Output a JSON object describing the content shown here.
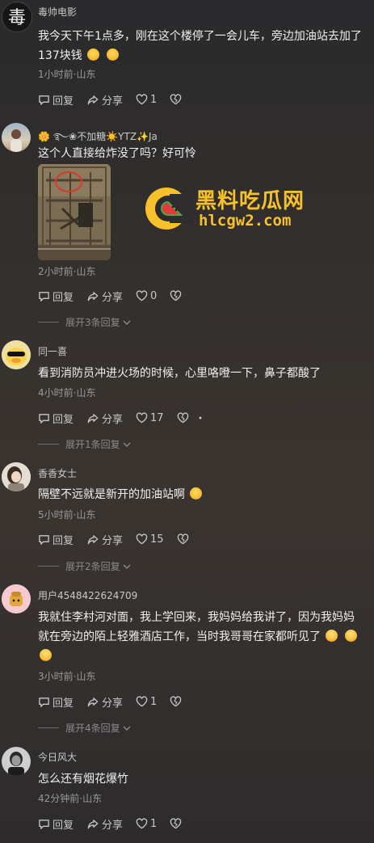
{
  "comments": [
    {
      "username": "毒帅电影",
      "text": "我今天下午1点多，刚在这个楼停了一会儿车，旁边加油站去加了137块钱",
      "meta": "1小时前·山东",
      "reply": "回复",
      "share": "分享",
      "likes": "1"
    },
    {
      "username": "🌼 ࿐❀不加糖☀️YTZ✨Ja",
      "text": "这个人直接给炸没了吗？好可怜",
      "meta": "2小时前·山东",
      "reply": "回复",
      "share": "分享",
      "likes": "0",
      "expand": "展开3条回复"
    },
    {
      "username": "同一喜",
      "text": "看到消防员冲进火场的时候，心里咯噔一下，鼻子都酸了",
      "meta": "4小时前·山东",
      "reply": "回复",
      "share": "分享",
      "likes": "17",
      "expand": "展开1条回复"
    },
    {
      "username": "香香女士",
      "text": "隔壁不远就是新开的加油站啊",
      "meta": "5小时前·山东",
      "reply": "回复",
      "share": "分享",
      "likes": "15",
      "expand": "展开2条回复"
    },
    {
      "username": "用户4548422624709",
      "text": "我就住李村河对面，我上学回来，我妈妈给我讲了，因为我妈妈就在旁边的陌上轻雅酒店工作，当时我哥哥在家都听见了",
      "meta": "3小时前·山东",
      "reply": "回复",
      "share": "分享",
      "likes": "1",
      "expand": "展开4条回复"
    },
    {
      "username": "今日风大",
      "text": "怎么还有烟花爆竹",
      "meta": "42分钟前·山东",
      "reply": "回复",
      "share": "分享",
      "likes": "1"
    }
  ],
  "watermark": {
    "title": "黑料吃瓜网",
    "url": "hlcgw2.com"
  },
  "colors": {
    "watermark_yellow": "#f6c12b",
    "text": "#f0f0f0",
    "meta": "#9a9a9a"
  }
}
